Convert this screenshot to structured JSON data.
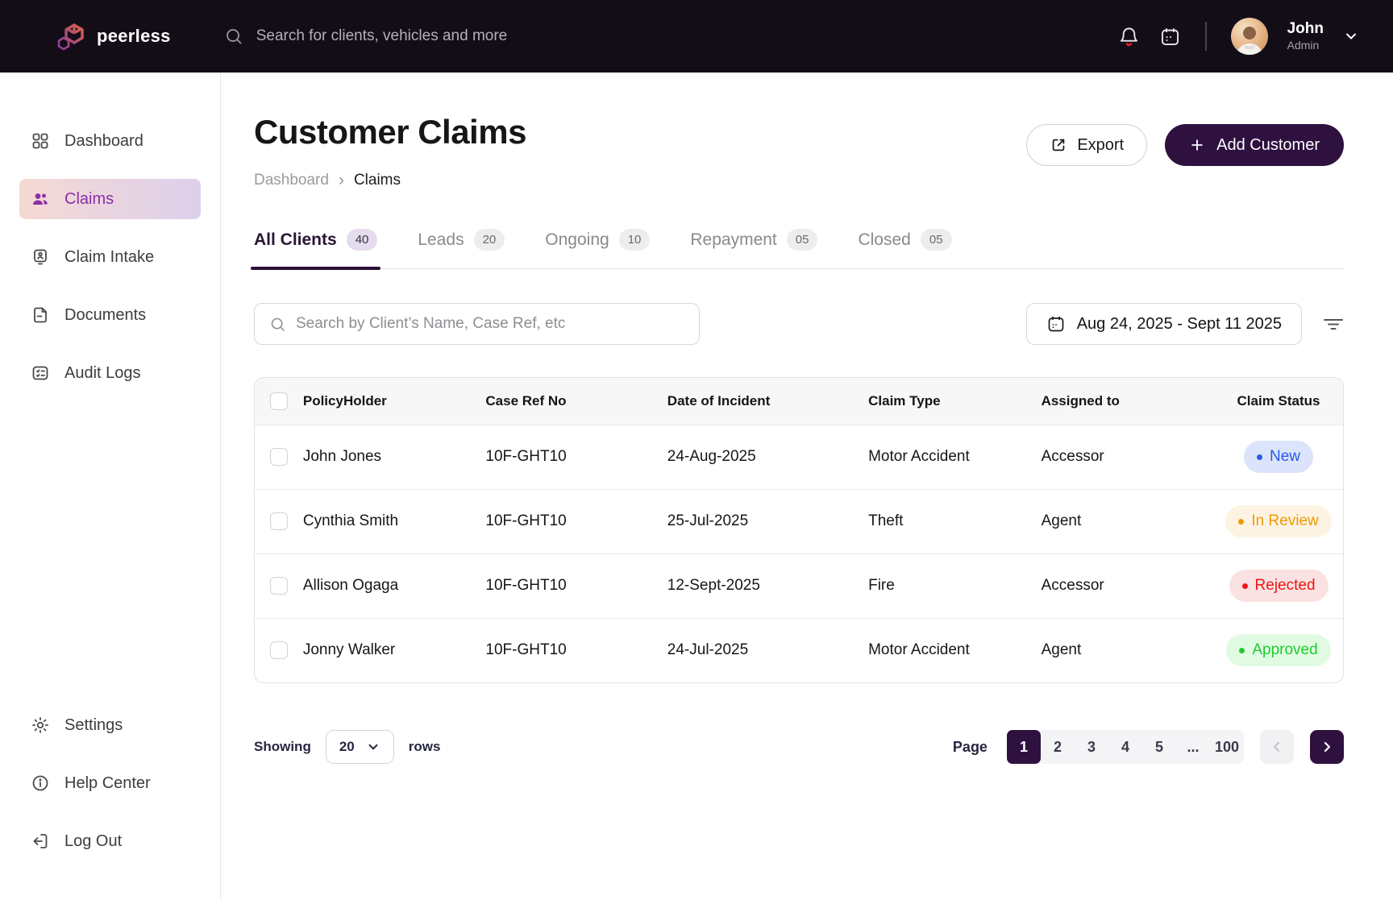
{
  "colors": {
    "topbar_bg": "#130d18",
    "accent_dark": "#2f1140",
    "brand_purple": "#8a2fa9",
    "sidebar_active_bg": "linear-gradient(90deg, #f5d9d3 0%, #ddd0ec 100%)",
    "logo_gradient_from": "#8b3f9f",
    "logo_gradient_to": "#e2663d",
    "notification_dot": "#e02020"
  },
  "icons": [
    "search-icon",
    "bell-icon",
    "calendar-icon",
    "chevron-down-icon",
    "grid-icon",
    "users-icon",
    "badge-icon",
    "document-icon",
    "checklist-icon",
    "gear-icon",
    "info-icon",
    "logout-icon",
    "export-icon",
    "plus-icon",
    "filter-icon",
    "chevron-left-icon",
    "chevron-right-icon",
    "breadcrumb-chevron-icon"
  ],
  "topbar": {
    "brand": "peerless",
    "search_placeholder": "Search for clients, vehicles and more",
    "user": {
      "name": "John",
      "role": "Admin"
    }
  },
  "sidebar": {
    "items": [
      {
        "label": "Dashboard"
      },
      {
        "label": "Claims",
        "active": true
      },
      {
        "label": "Claim Intake"
      },
      {
        "label": "Documents"
      },
      {
        "label": "Audit Logs"
      }
    ],
    "footer_items": [
      {
        "label": "Settings"
      },
      {
        "label": "Help Center"
      },
      {
        "label": "Log Out"
      }
    ]
  },
  "header": {
    "title": "Customer Claims",
    "breadcrumb": {
      "parent": "Dashboard",
      "separator": "›",
      "current": "Claims"
    },
    "export_label": "Export",
    "add_customer_label": "Add Customer"
  },
  "tabs": [
    {
      "label": "All Clients",
      "count": "40",
      "active": true
    },
    {
      "label": "Leads",
      "count": "20",
      "active": false
    },
    {
      "label": "Ongoing",
      "count": "10",
      "active": false
    },
    {
      "label": "Repayment",
      "count": "05",
      "active": false
    },
    {
      "label": "Closed",
      "count": "05",
      "active": false
    }
  ],
  "filters": {
    "search_placeholder": "Search by Client’s Name, Case Ref, etc",
    "date_range": "Aug 24, 2025 - Sept 11 2025"
  },
  "table": {
    "columns": {
      "policyholder": "PolicyHolder",
      "case_ref": "Case Ref No",
      "date": "Date of Incident",
      "claim_type": "Claim Type",
      "assigned_to": "Assigned to",
      "status": "Claim Status"
    },
    "rows": [
      {
        "policyholder": "John Jones",
        "case_ref": "10F-GHT10",
        "date": "24-Aug-2025",
        "claim_type": "Motor Accident",
        "assigned_to": "Accessor",
        "status": "New",
        "status_color": "#2b59e8",
        "status_bg": "#dbe4fb"
      },
      {
        "policyholder": "Cynthia Smith",
        "case_ref": "10F-GHT10",
        "date": "25-Jul-2025",
        "claim_type": "Theft",
        "assigned_to": "Agent",
        "status": "In Review",
        "status_color": "#f09a00",
        "status_bg": "#fdf3e3"
      },
      {
        "policyholder": "Allison Ogaga",
        "case_ref": "10F-GHT10",
        "date": "12-Sept-2025",
        "claim_type": "Fire",
        "assigned_to": "Accessor",
        "status": "Rejected",
        "status_color": "#ee1414",
        "status_bg": "#fbe2e2"
      },
      {
        "policyholder": "Jonny Walker",
        "case_ref": "10F-GHT10",
        "date": "24-Jul-2025",
        "claim_type": "Motor Accident",
        "assigned_to": "Agent",
        "status": "Approved",
        "status_color": "#1fcb30",
        "status_bg": "#e1fbe3"
      }
    ]
  },
  "pagination": {
    "showing_label": "Showing",
    "rows_per_page": "20",
    "rows_label": "rows",
    "page_label": "Page",
    "pages": [
      "1",
      "2",
      "3",
      "4",
      "5",
      "...",
      "100"
    ],
    "active_page": "1"
  }
}
